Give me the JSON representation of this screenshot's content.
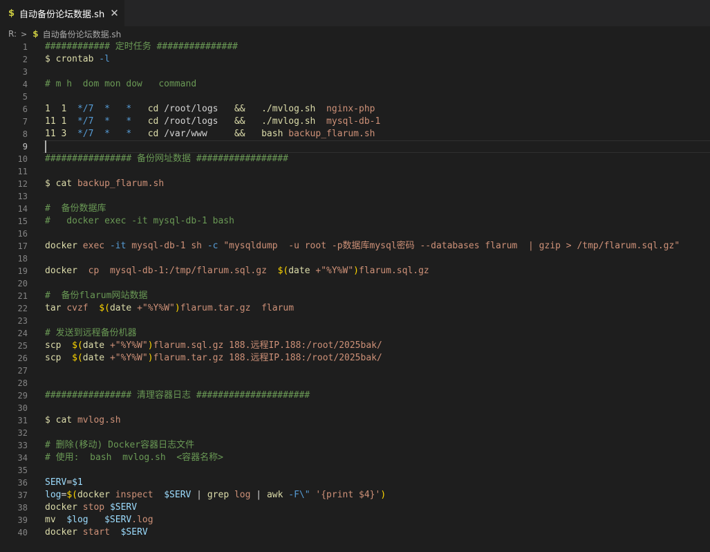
{
  "tab": {
    "icon": "$",
    "label": "自动备份论坛数据.sh",
    "close": "✕"
  },
  "breadcrumb": {
    "root": "R:",
    "sep": ">",
    "icon": "$",
    "file": "自动备份论坛数据.sh"
  },
  "editor": {
    "current_line": 9,
    "lines": [
      {
        "n": 1,
        "segs": [
          [
            "c",
            "############ 定时任务 ###############"
          ]
        ]
      },
      {
        "n": 2,
        "segs": [
          [
            "d",
            "$ "
          ],
          [
            "d",
            "crontab"
          ],
          [
            "t",
            " "
          ],
          [
            "k",
            "-l"
          ]
        ]
      },
      {
        "n": 3,
        "segs": []
      },
      {
        "n": 4,
        "segs": [
          [
            "c",
            "# m h  dom mon dow   command"
          ]
        ]
      },
      {
        "n": 5,
        "segs": []
      },
      {
        "n": 6,
        "segs": [
          [
            "d",
            "1  1  "
          ],
          [
            "k",
            "*/7  *   *"
          ],
          [
            "t",
            "   "
          ],
          [
            "d",
            "cd"
          ],
          [
            "t",
            " /root/logs   "
          ],
          [
            "d",
            "&&"
          ],
          [
            "t",
            "   "
          ],
          [
            "d",
            "./mvlog.sh"
          ],
          [
            "t",
            "  "
          ],
          [
            "f",
            "nginx-php"
          ]
        ]
      },
      {
        "n": 7,
        "segs": [
          [
            "d",
            "11 1  "
          ],
          [
            "k",
            "*/7  *   *"
          ],
          [
            "t",
            "   "
          ],
          [
            "d",
            "cd"
          ],
          [
            "t",
            " /root/logs   "
          ],
          [
            "d",
            "&&"
          ],
          [
            "t",
            "   "
          ],
          [
            "d",
            "./mvlog.sh"
          ],
          [
            "t",
            "  "
          ],
          [
            "f",
            "mysql-db-1"
          ]
        ]
      },
      {
        "n": 8,
        "segs": [
          [
            "d",
            "11 3  "
          ],
          [
            "k",
            "*/7  *   *"
          ],
          [
            "t",
            "   "
          ],
          [
            "d",
            "cd"
          ],
          [
            "t",
            " /var/www     "
          ],
          [
            "d",
            "&&"
          ],
          [
            "t",
            "   "
          ],
          [
            "d",
            "bash"
          ],
          [
            "t",
            " "
          ],
          [
            "f",
            "backup_flarum.sh"
          ]
        ]
      },
      {
        "n": 9,
        "segs": []
      },
      {
        "n": 10,
        "segs": [
          [
            "c",
            "################ 备份网址数据 #################"
          ]
        ]
      },
      {
        "n": 11,
        "segs": []
      },
      {
        "n": 12,
        "segs": [
          [
            "d",
            "$ cat"
          ],
          [
            "t",
            " "
          ],
          [
            "f",
            "backup_flarum.sh"
          ]
        ]
      },
      {
        "n": 13,
        "segs": []
      },
      {
        "n": 14,
        "segs": [
          [
            "c",
            "#  备份数据库"
          ]
        ]
      },
      {
        "n": 15,
        "segs": [
          [
            "c",
            "#   docker exec -it mysql-db-1 bash"
          ]
        ]
      },
      {
        "n": 16,
        "segs": []
      },
      {
        "n": 17,
        "segs": [
          [
            "d",
            "docker"
          ],
          [
            "t",
            " "
          ],
          [
            "f",
            "exec"
          ],
          [
            "t",
            " "
          ],
          [
            "k",
            "-it"
          ],
          [
            "t",
            " "
          ],
          [
            "f",
            "mysql-db-1"
          ],
          [
            "t",
            " "
          ],
          [
            "f",
            "sh"
          ],
          [
            "t",
            " "
          ],
          [
            "k",
            "-c"
          ],
          [
            "t",
            " "
          ],
          [
            "f",
            "\"mysqldump  -u root -p数据库mysql密码 --databases flarum  | gzip > /tmp/flarum.sql.gz\""
          ]
        ]
      },
      {
        "n": 18,
        "segs": []
      },
      {
        "n": 19,
        "segs": [
          [
            "d",
            "docker"
          ],
          [
            "t",
            "  "
          ],
          [
            "f",
            "cp"
          ],
          [
            "t",
            "  "
          ],
          [
            "f",
            "mysql-db-1:/tmp/flarum.sql.gz"
          ],
          [
            "t",
            "  "
          ],
          [
            "y",
            "$("
          ],
          [
            "d",
            "date"
          ],
          [
            "t",
            " "
          ],
          [
            "f",
            "+\"%Y%W\""
          ],
          [
            "y",
            ")"
          ],
          [
            "f",
            "flarum.sql.gz"
          ]
        ]
      },
      {
        "n": 20,
        "segs": []
      },
      {
        "n": 21,
        "segs": [
          [
            "c",
            "#  备份flarum网站数据"
          ]
        ]
      },
      {
        "n": 22,
        "segs": [
          [
            "d",
            "tar"
          ],
          [
            "t",
            " "
          ],
          [
            "f",
            "cvzf"
          ],
          [
            "t",
            "  "
          ],
          [
            "y",
            "$("
          ],
          [
            "d",
            "date"
          ],
          [
            "t",
            " "
          ],
          [
            "f",
            "+\"%Y%W\""
          ],
          [
            "y",
            ")"
          ],
          [
            "f",
            "flarum.tar.gz"
          ],
          [
            "t",
            "  "
          ],
          [
            "f",
            "flarum"
          ]
        ]
      },
      {
        "n": 23,
        "segs": []
      },
      {
        "n": 24,
        "segs": [
          [
            "c",
            "# 发送到远程备份机器"
          ]
        ]
      },
      {
        "n": 25,
        "segs": [
          [
            "d",
            "scp"
          ],
          [
            "t",
            "  "
          ],
          [
            "y",
            "$("
          ],
          [
            "d",
            "date"
          ],
          [
            "t",
            " "
          ],
          [
            "f",
            "+\"%Y%W\""
          ],
          [
            "y",
            ")"
          ],
          [
            "f",
            "flarum.sql.gz"
          ],
          [
            "t",
            " "
          ],
          [
            "f",
            "188.远程IP.188:/root/2025bak/"
          ]
        ]
      },
      {
        "n": 26,
        "segs": [
          [
            "d",
            "scp"
          ],
          [
            "t",
            "  "
          ],
          [
            "y",
            "$("
          ],
          [
            "d",
            "date"
          ],
          [
            "t",
            " "
          ],
          [
            "f",
            "+\"%Y%W\""
          ],
          [
            "y",
            ")"
          ],
          [
            "f",
            "flarum.tar.gz"
          ],
          [
            "t",
            " "
          ],
          [
            "f",
            "188.远程IP.188:/root/2025bak/"
          ]
        ]
      },
      {
        "n": 27,
        "segs": []
      },
      {
        "n": 28,
        "segs": []
      },
      {
        "n": 29,
        "segs": [
          [
            "c",
            "################ 清理容器日志 #####################"
          ]
        ]
      },
      {
        "n": 30,
        "segs": []
      },
      {
        "n": 31,
        "segs": [
          [
            "d",
            "$ cat"
          ],
          [
            "t",
            " "
          ],
          [
            "f",
            "mvlog.sh"
          ]
        ]
      },
      {
        "n": 32,
        "segs": []
      },
      {
        "n": 33,
        "segs": [
          [
            "c",
            "# 删除(移动) Docker容器日志文件"
          ]
        ]
      },
      {
        "n": 34,
        "segs": [
          [
            "c",
            "# 使用:  bash  mvlog.sh  <容器名称>"
          ]
        ]
      },
      {
        "n": 35,
        "segs": []
      },
      {
        "n": 36,
        "segs": [
          [
            "v",
            "SERV"
          ],
          [
            "t",
            "="
          ],
          [
            "v",
            "$1"
          ]
        ]
      },
      {
        "n": 37,
        "segs": [
          [
            "v",
            "log"
          ],
          [
            "t",
            "="
          ],
          [
            "y",
            "$("
          ],
          [
            "d",
            "docker"
          ],
          [
            "t",
            " "
          ],
          [
            "f",
            "inspect"
          ],
          [
            "t",
            "  "
          ],
          [
            "v",
            "$SERV"
          ],
          [
            "t",
            " | "
          ],
          [
            "d",
            "grep"
          ],
          [
            "t",
            " "
          ],
          [
            "f",
            "log"
          ],
          [
            "t",
            " | "
          ],
          [
            "d",
            "awk"
          ],
          [
            "t",
            " "
          ],
          [
            "k",
            "-F\\\""
          ],
          [
            "t",
            " "
          ],
          [
            "f",
            "'{print $4}'"
          ],
          [
            "y",
            ")"
          ]
        ]
      },
      {
        "n": 38,
        "segs": [
          [
            "d",
            "docker"
          ],
          [
            "t",
            " "
          ],
          [
            "f",
            "stop"
          ],
          [
            "t",
            " "
          ],
          [
            "v",
            "$SERV"
          ]
        ]
      },
      {
        "n": 39,
        "segs": [
          [
            "d",
            "mv"
          ],
          [
            "t",
            "  "
          ],
          [
            "v",
            "$log"
          ],
          [
            "t",
            "   "
          ],
          [
            "v",
            "$SERV"
          ],
          [
            "f",
            ".log"
          ]
        ]
      },
      {
        "n": 40,
        "segs": [
          [
            "d",
            "docker"
          ],
          [
            "t",
            " "
          ],
          [
            "f",
            "start"
          ],
          [
            "t",
            "  "
          ],
          [
            "v",
            "$SERV"
          ]
        ]
      }
    ]
  }
}
